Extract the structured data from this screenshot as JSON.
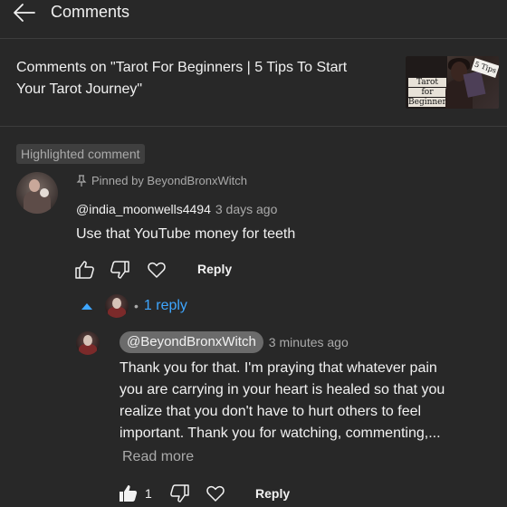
{
  "header": {
    "title": "Comments",
    "back_icon": "arrow-left-icon"
  },
  "video": {
    "title": "Comments on \"Tarot For Beginners | 5 Tips To Start Your Tarot Journey\"",
    "thumbnail": {
      "line1": "Tarot",
      "line2": "for",
      "line3": "Beginners",
      "badge": "5 Tips"
    }
  },
  "comment": {
    "highlighted_label": "Highlighted comment",
    "pinned_label": "Pinned by BeyondBronxWitch",
    "author": "@india_moonwells4494",
    "time": "3 days ago",
    "text": "Use that YouTube money for teeth",
    "reply_label": "Reply"
  },
  "replies": {
    "count_label": "1 reply",
    "dot": "•",
    "reply": {
      "author": "@BeyondBronxWitch",
      "time": "3 minutes ago",
      "line1": "Thank you for that. I'm praying that whatever pain",
      "line2": "you are carrying in your heart is healed so that you",
      "line3": "realize that you don't have to hurt others to feel",
      "line4": "important. Thank you for watching, commenting,...",
      "read_more": "Read more",
      "like_count": "1",
      "reply_label": "Reply"
    }
  },
  "colors": {
    "background": "#282828",
    "link_blue": "#3ea6ff",
    "muted": "#aaaaaa",
    "text": "#f1f1f1"
  }
}
